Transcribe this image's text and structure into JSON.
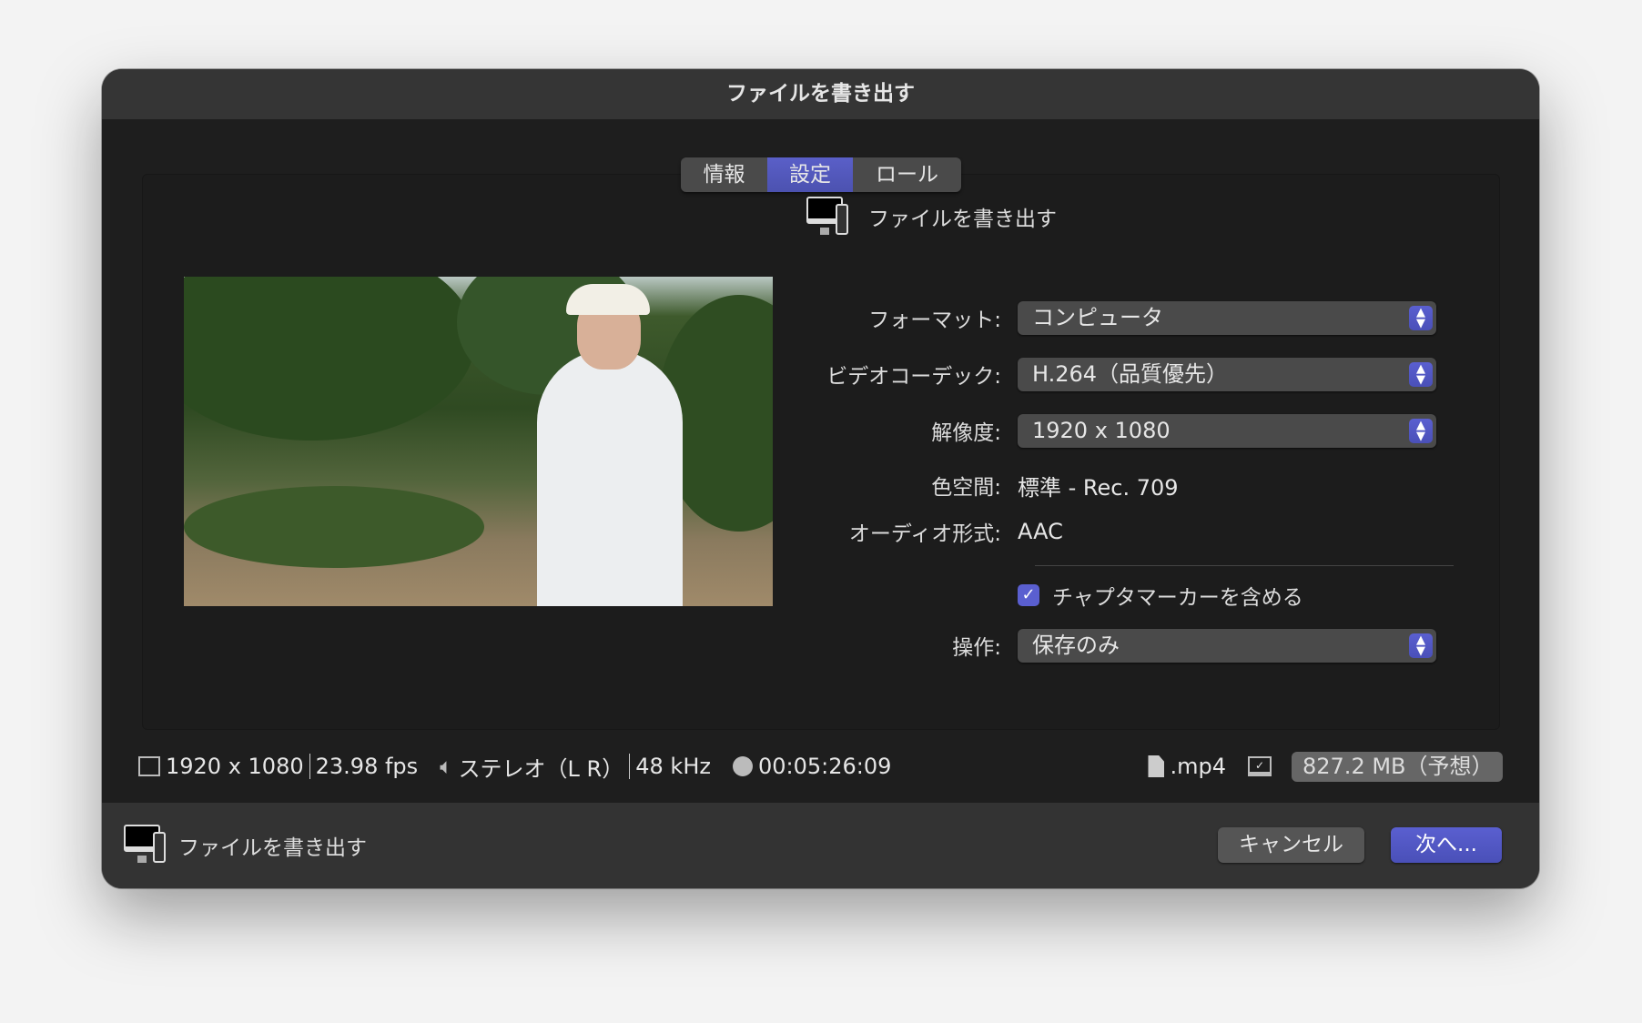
{
  "window": {
    "title": "ファイルを書き出す"
  },
  "tabs": [
    {
      "label": "情報",
      "active": false
    },
    {
      "label": "設定",
      "active": true
    },
    {
      "label": "ロール",
      "active": false
    }
  ],
  "section": {
    "title": "ファイルを書き出す",
    "icon": "computer-phone-icon"
  },
  "settings": {
    "format": {
      "label": "フォーマット:",
      "value": "コンピュータ"
    },
    "codec": {
      "label": "ビデオコーデック:",
      "value": "H.264（品質優先）"
    },
    "resolution": {
      "label": "解像度:",
      "value": "1920 x 1080"
    },
    "colorspace": {
      "label": "色空間:",
      "value": "標準 - Rec. 709"
    },
    "audio": {
      "label": "オーディオ形式:",
      "value": "AAC"
    },
    "chapters": {
      "label": "チャプタマーカーを含める",
      "checked": true
    },
    "action": {
      "label": "操作:",
      "value": "保存のみ"
    }
  },
  "status": {
    "resolution": "1920 x 1080",
    "fps": "23.98 fps",
    "channels": "ステレオ（L R）",
    "rate": "48 kHz",
    "duration": "00:05:26:09",
    "ext": ".mp4",
    "size": "827.2 MB（予想）"
  },
  "footer": {
    "title": "ファイルを書き出す",
    "cancel": "キャンセル",
    "next": "次へ..."
  },
  "colors": {
    "accent": "#5a5fd0"
  }
}
